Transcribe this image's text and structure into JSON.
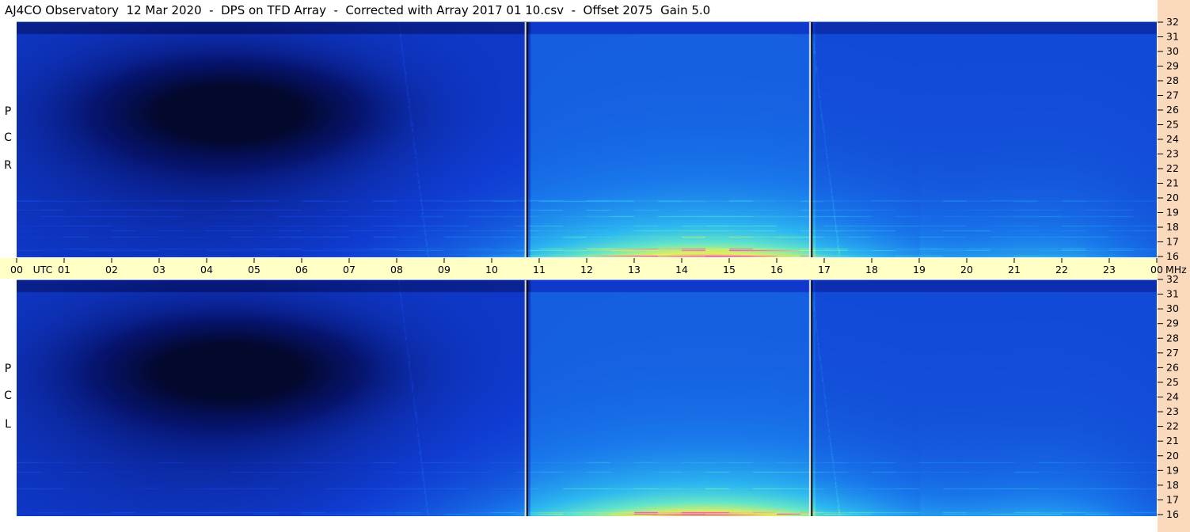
{
  "title": "AJ4CO Observatory  12 Mar 2020  -  DPS on TFD Array  -  Corrected with Array 2017 01 10.csv  -  Offset 2075  Gain 5.0",
  "colors": {
    "dark_navy": "#030b35",
    "blue": "#1040e0",
    "cyan": "#2bb8f0",
    "right_strip": "#fad9bd",
    "time_band": "#ffffc6"
  },
  "chart_data": {
    "type": "heatmap",
    "title": "AJ4CO Observatory  12 Mar 2020  -  DPS on TFD Array  -  Corrected with Array 2017 01 10.csv  -  Offset 2075  Gain 5.0",
    "x": {
      "unit_label": "UTC",
      "range": [
        0,
        24
      ],
      "ticks": [
        "00",
        "01",
        "02",
        "03",
        "04",
        "05",
        "06",
        "07",
        "08",
        "09",
        "10",
        "11",
        "12",
        "13",
        "14",
        "15",
        "16",
        "17",
        "18",
        "19",
        "20",
        "21",
        "22",
        "23",
        "00"
      ]
    },
    "y": {
      "unit_label": "MHz",
      "range": [
        16,
        32
      ],
      "ticks": [
        "16",
        "17",
        "18",
        "19",
        "20",
        "21",
        "22",
        "23",
        "24",
        "25",
        "26",
        "27",
        "28",
        "29",
        "30",
        "31",
        "32"
      ]
    },
    "panels": [
      {
        "name": "RCP",
        "label_letters": [
          "P",
          "C",
          "R"
        ]
      },
      {
        "name": "LCP",
        "label_letters": [
          "P",
          "C",
          "L"
        ]
      }
    ],
    "vertical_markers_utc": [
      10.73,
      16.72
    ],
    "colormap": "dark navy (low) - blue - cyan - yellow - magenta (high)"
  }
}
